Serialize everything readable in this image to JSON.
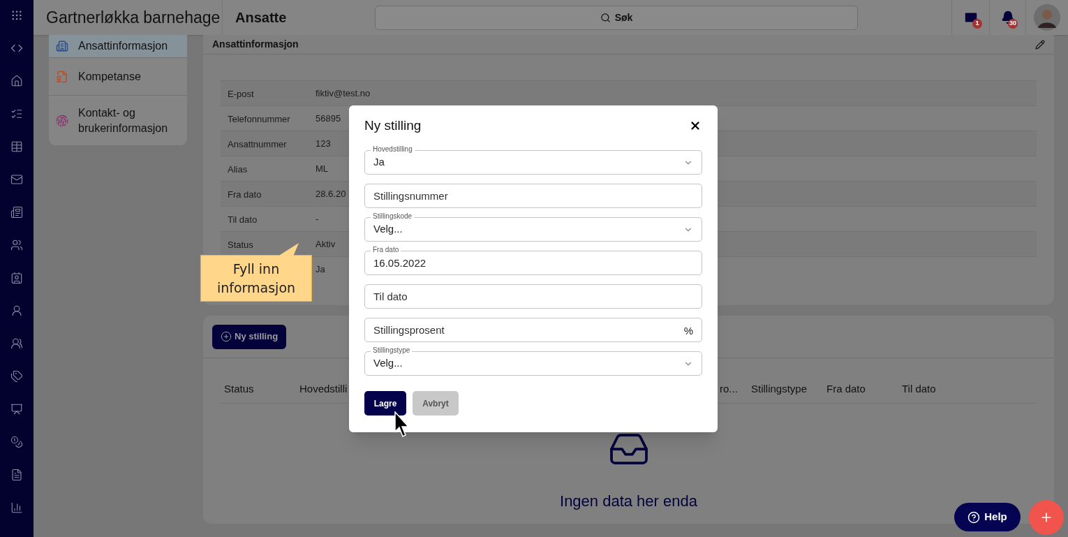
{
  "header": {
    "title": "Gartnerløkka barnehage",
    "section": "Ansatte",
    "search": {
      "placeholder": "Søk"
    },
    "mail_badge": "1",
    "notification_badge": "30"
  },
  "side_menu": [
    {
      "label": "Ansattinformasjon",
      "selected": true
    },
    {
      "label": "Kompetanse",
      "selected": false
    },
    {
      "label": "Kontakt- og brukerinformasjon",
      "selected": false
    }
  ],
  "info_panel": {
    "title": "Ansattinformasjon",
    "rows": [
      {
        "label": "E-post",
        "value": "fiktiv@test.no"
      },
      {
        "label": "Telefonnummer",
        "value": "56895"
      },
      {
        "label": "Ansattnummer",
        "value": "123"
      },
      {
        "label": "Alias",
        "value": "ML"
      },
      {
        "label": "Fra dato",
        "value": "28.6.20"
      },
      {
        "label": "Til dato",
        "value": "-"
      },
      {
        "label": "Status",
        "value": "Aktiv"
      },
      {
        "value": "Ja"
      }
    ]
  },
  "positions_panel": {
    "add_button": "Ny stilling",
    "columns": [
      "Status",
      "Hovedstilli",
      "ro...",
      "Stillingstype",
      "Fra dato",
      "Til dato"
    ],
    "empty_text": "Ingen data her enda"
  },
  "dialog": {
    "title": "Ny stilling",
    "fields": [
      {
        "kind": "select",
        "label": "Hovedstilling",
        "value": "Ja"
      },
      {
        "kind": "input",
        "placeholder": "Stillingsnummer"
      },
      {
        "kind": "select",
        "label": "Stillingskode",
        "value": "Velg..."
      },
      {
        "kind": "input",
        "label": "Fra dato",
        "value": "16.05.2022"
      },
      {
        "kind": "input",
        "placeholder": "Til dato"
      },
      {
        "kind": "input",
        "placeholder": "Stillingsprosent",
        "suffix": "%"
      },
      {
        "kind": "select",
        "label": "Stillingstype",
        "value": "Velg..."
      }
    ],
    "buttons": [
      {
        "label": "Lagre",
        "kind": "primary"
      },
      {
        "label": "Avbryt",
        "kind": "secondary"
      }
    ]
  },
  "callout": "Fyll inn informasjon",
  "help_button": "Help"
}
